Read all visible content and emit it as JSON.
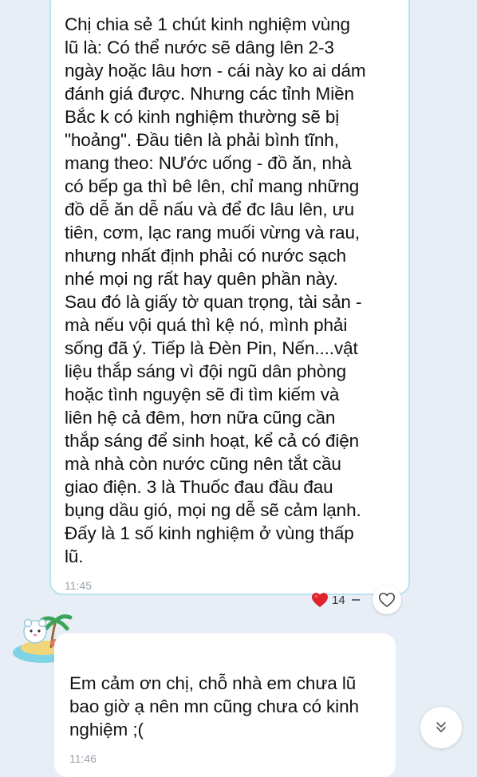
{
  "messages": {
    "sent": {
      "text": "Chị chia sẻ 1 chút kinh nghiệm vùng\nlũ là: Có thể nước sẽ dâng lên 2-3\nngày hoặc lâu hơn - cái này ko ai dám\nđánh giá được. Nhưng các tỉnh Miền\nBắc k có kinh nghiệm thường sẽ bị\n\"hoảng\". Đầu tiên là phải bình tĩnh,\nmang theo: NƯớc uống - đồ ăn, nhà\ncó bếp ga thì bê lên, chỉ mang những\nđồ dễ ăn dễ nấu và để đc lâu lên, ưu\ntiên, cơm, lạc rang muối vừng và rau,\nnhưng nhất định phải có nước sạch\nnhé mọi ng rất hay quên phần này.\nSau đó là giấy tờ quan trọng, tài sản -\nmà nếu vội quá thì kệ nó, mình phải\nsống đã ý. Tiếp là Đèn Pin, Nến....vật\nliệu thắp sáng vì đội  ngũ dân phòng\nhoặc tình nguyện sẽ đi tìm kiếm và\nliên hệ cả đêm, hơn nữa cũng cần\nthắp sáng để sinh hoạt, kể cả có điện\nmà nhà còn nước cũng nên tắt cầu\ngiao điện. 3 là Thuốc đau đầu đau\nbụng dầu gió, mọi ng dễ sẽ cảm lạnh.\nĐấy là 1 số kinh nghiệm ở vùng thấp\nlũ.",
      "time": "11:45",
      "reaction_count": "14"
    },
    "received": {
      "text": "Em cảm ơn chị, chỗ nhà em chưa lũ\nbao giờ ạ nên mn cũng chưa có kinh\nnghiệm ;(",
      "time": "11:46"
    }
  },
  "icons": {
    "reaction": "heart-icon",
    "like": "heart-outline-icon",
    "scroll": "double-chevron-down-icon",
    "avatar": "island-avatar"
  },
  "colors": {
    "background": "#e8eef6",
    "bubble": "#ffffff",
    "sent_border": "#b9e3f2",
    "heart": "#e0212e",
    "time": "#9aa3ad"
  }
}
